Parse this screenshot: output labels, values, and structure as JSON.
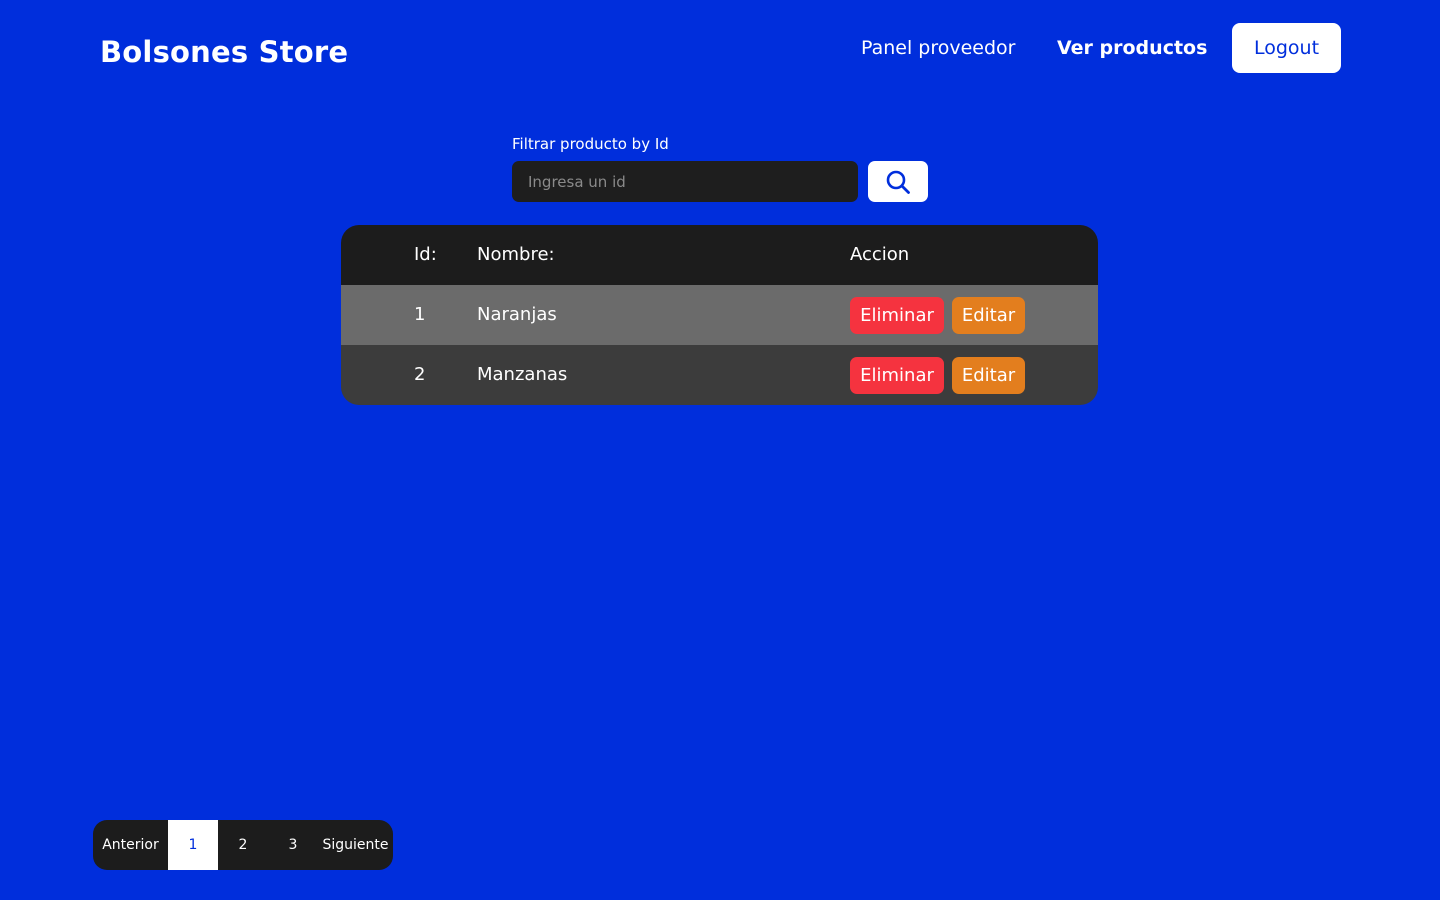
{
  "header": {
    "brand": "Bolsones Store",
    "nav": {
      "panel": "Panel proveedor",
      "ver_productos": "Ver productos",
      "logout": "Logout"
    }
  },
  "filter": {
    "label": "Filtrar producto by Id",
    "placeholder": "Ingresa un id",
    "value": "",
    "search_icon": "search-icon"
  },
  "table": {
    "headers": {
      "id": "Id:",
      "name": "Nombre:",
      "action": "Accion"
    },
    "rows": [
      {
        "id": "1",
        "name": "Naranjas",
        "delete": "Eliminar",
        "edit": "Editar"
      },
      {
        "id": "2",
        "name": "Manzanas",
        "delete": "Eliminar",
        "edit": "Editar"
      }
    ]
  },
  "pagination": {
    "prev": "Anterior",
    "pages": [
      "1",
      "2",
      "3"
    ],
    "current": "1",
    "next": "Siguiente"
  },
  "colors": {
    "background": "#002edc",
    "table_header": "#1c1c1c",
    "row_odd": "#6b6b6b",
    "row_even": "#3c3c3c",
    "delete": "#f5333f",
    "edit": "#e37e1e"
  }
}
